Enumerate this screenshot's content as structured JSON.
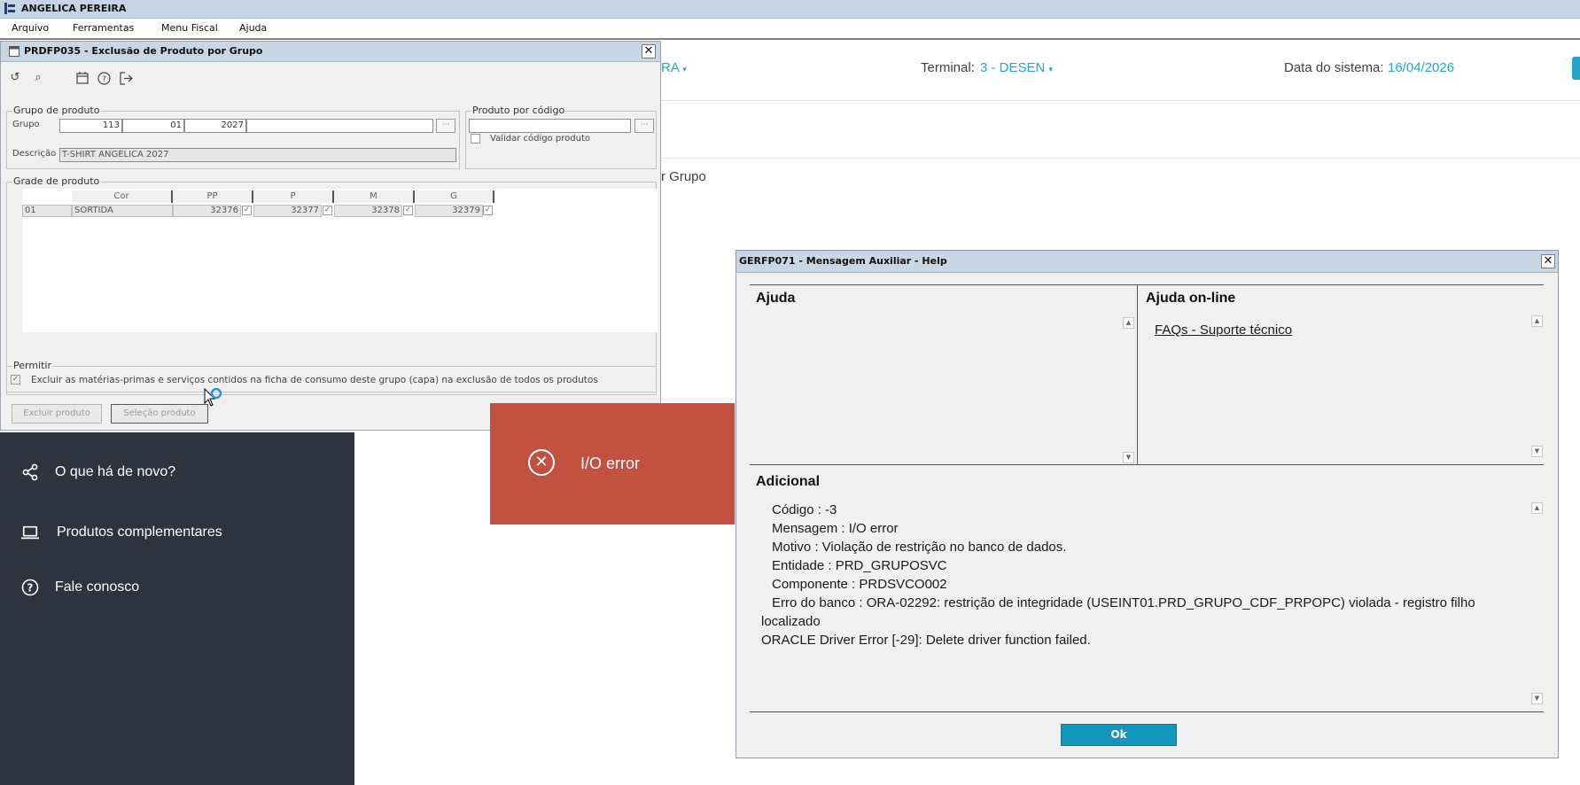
{
  "app": {
    "title": "ANGELICA PEREIRA"
  },
  "menubar": {
    "items": [
      {
        "label": "Arquivo"
      },
      {
        "label": "Ferramentas"
      },
      {
        "label": "Menu Fiscal"
      },
      {
        "label": "Ajuda"
      }
    ]
  },
  "background_page": {
    "partial_user": "RA",
    "terminal_label": "Terminal:",
    "terminal_value": "3 - DESEN",
    "date_label": "Data do sistema:",
    "date_value": "16/04/2026",
    "partial_title": "r Grupo"
  },
  "sidebar": {
    "items": [
      {
        "label": "O que há de novo?",
        "icon": "share-icon"
      },
      {
        "label": "Produtos complementares",
        "icon": "laptop-icon"
      },
      {
        "label": "Fale conosco",
        "icon": "help-circle-icon"
      }
    ]
  },
  "prdfp035": {
    "title": "PRDFP035 - Exclusão de Produto por Grupo",
    "grupo_produto": {
      "legend": "Grupo de produto",
      "grupo_label": "Grupo",
      "grupo_values": [
        "113",
        "01",
        "2027"
      ],
      "descricao_label": "Descrição",
      "descricao_value": "T-SHIRT ANGELICA 2027"
    },
    "produto_codigo": {
      "legend": "Produto por código",
      "validar_label": "Validar código produto"
    },
    "grade": {
      "legend": "Grade de produto",
      "columns": [
        "Cor",
        "PP",
        "P",
        "M",
        "G"
      ],
      "rows": [
        {
          "code": "01",
          "cor": "SORTIDA",
          "pp": "32376",
          "p": "32377",
          "m": "32378",
          "g": "32379"
        }
      ]
    },
    "permitir": {
      "legend": "Permitir",
      "option": "Excluir as matérias-primas e serviços contidos na ficha de consumo deste grupo (capa) na exclusão de todos os produtos",
      "checked": true
    },
    "buttons": {
      "excluir": "Excluir produto",
      "selecao": "Seleção produto"
    }
  },
  "toast": {
    "message": "I/O error",
    "color": "#c35142"
  },
  "gerfp071": {
    "title": "GERFP071 - Mensagem Auxiliar - Help",
    "ajuda_title": "Ajuda",
    "online_title": "Ajuda on-line",
    "online_link": "FAQs - Suporte técnico",
    "adicional_title": "Adicional",
    "details": [
      "Código : -3",
      "Mensagem : I/O error",
      "Motivo : Violação de restrição no banco de dados.",
      "Entidade : PRD_GRUPOSVC",
      "Componente : PRDSVCO002",
      "Erro do banco : ORA-02292: restrição de integridade (USEINT01.PRD_GRUPO_CDF_PRPOPC) violada - registro filho",
      "localizado",
      "ORACLE Driver Error [-29]: Delete driver function failed."
    ],
    "ok_label": "Ok"
  },
  "colors": {
    "accent": "#24a4c9",
    "ok_button": "#1495bd",
    "sidebar_bg": "#2f333f"
  }
}
